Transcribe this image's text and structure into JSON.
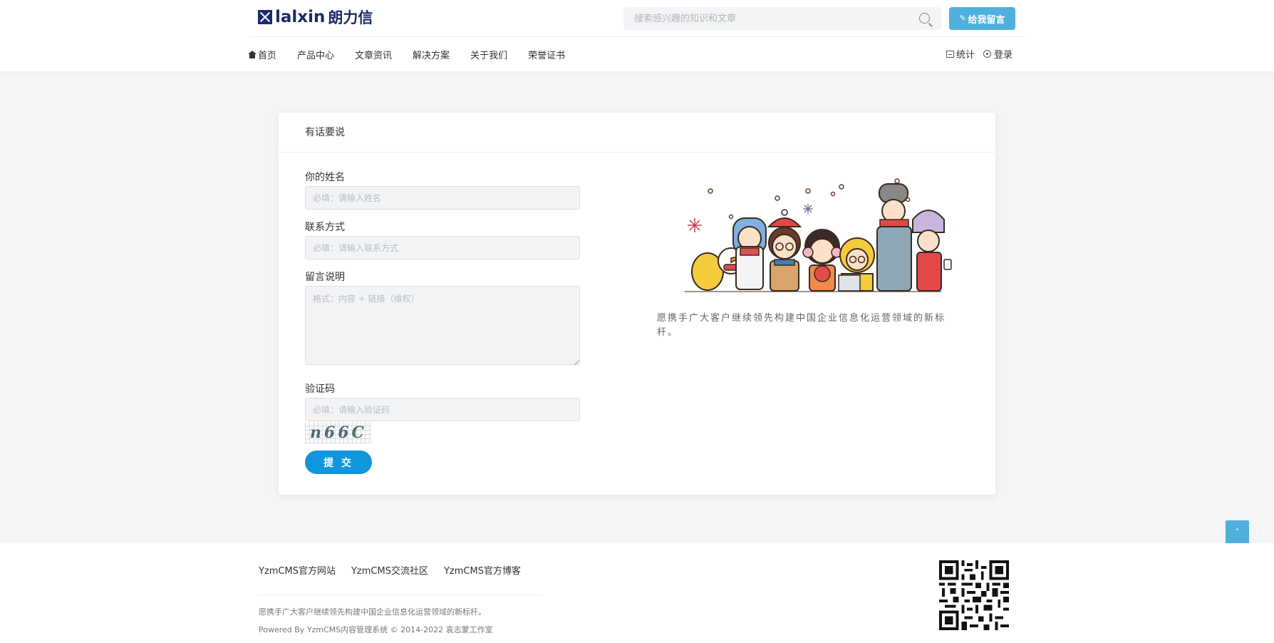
{
  "header": {
    "logo_text": "lalxin",
    "logo_cn": "朗力信",
    "search_placeholder": "搜索感兴趣的知识和文章",
    "message_button": "给我留言",
    "nav": [
      {
        "label": "首页"
      },
      {
        "label": "产品中心"
      },
      {
        "label": "文章资讯"
      },
      {
        "label": "解决方案"
      },
      {
        "label": "关于我们"
      },
      {
        "label": "荣誉证书"
      }
    ],
    "stats_label": "统计",
    "login_label": "登录"
  },
  "card": {
    "title": "有话要说",
    "name_label": "你的姓名",
    "name_placeholder": "必填：请输入姓名",
    "contact_label": "联系方式",
    "contact_placeholder": "必填：请输入联系方式",
    "message_label": "留言说明",
    "message_placeholder": "格式：内容 + 链接（维权）",
    "captcha_label": "验证码",
    "captcha_placeholder": "必填：请输入验证码",
    "captcha_text": "n66C",
    "submit_label": "提 交",
    "slogan": "愿携手广大客户继续领先构建中国企业信息化运营领域的新标杆。"
  },
  "footer": {
    "links": [
      "YzmCMS官方网站",
      "YzmCMS交流社区",
      "YzmCMS官方博客"
    ],
    "desc": "愿携手广大客户继续领先构建中国企业信息化运营领域的新标杆。",
    "copyright": "Powered By YzmCMS内容管理系统 © 2014-2022 袁志蒙工作室"
  },
  "colors": {
    "accent": "#4fb0dd",
    "submit": "#1296db",
    "logo": "#1b2a6b"
  }
}
